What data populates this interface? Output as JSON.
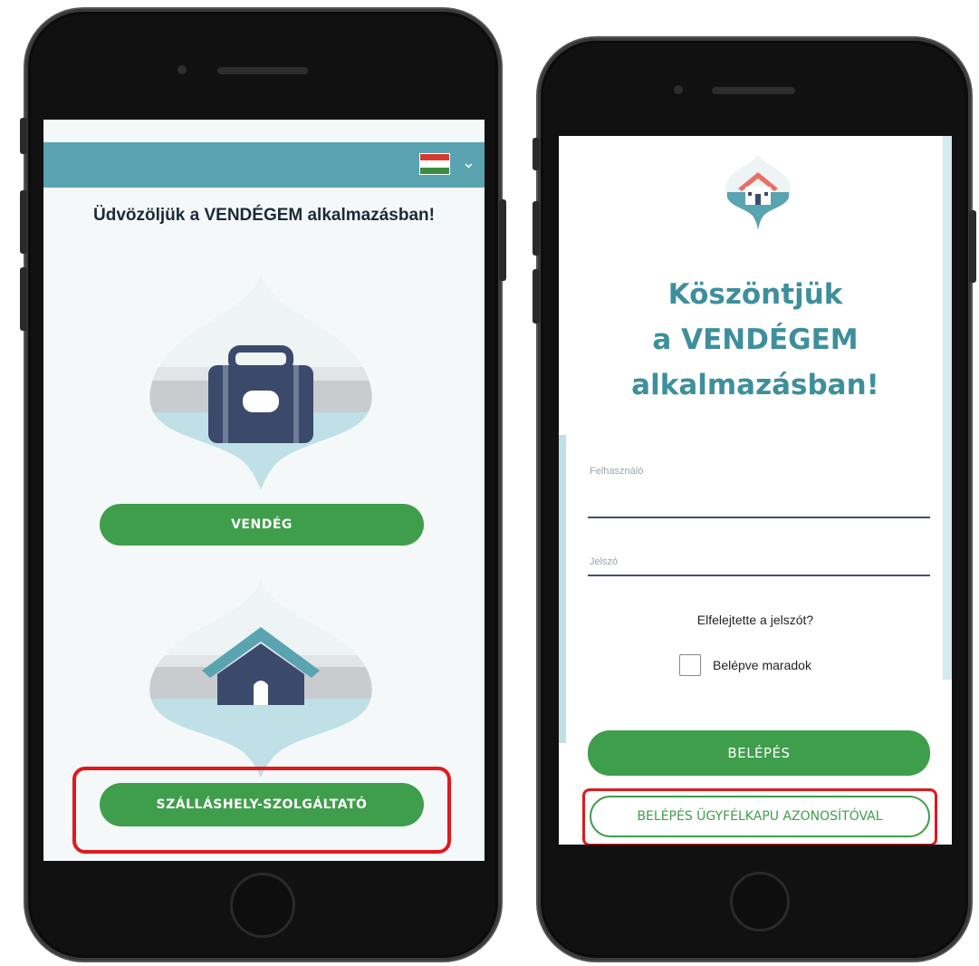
{
  "left_screen": {
    "language_flag": "hungarian-flag",
    "welcome": "Üdvözöljük a VENDÉGEM alkalmazásban!",
    "guest_button": "VENDÉG",
    "provider_button": "SZÁLLÁSHELY-SZOLGÁLTATÓ"
  },
  "right_screen": {
    "title_lines": [
      "Köszöntjük",
      "a VENDÉGEM",
      "alkalmazásban!"
    ],
    "username_placeholder": "Felhasználó",
    "password_placeholder": "Jelszó",
    "forgot_password": "Elfelejtette a jelszót?",
    "stay_logged_in": "Belépve maradok",
    "login_button": "BELÉPÉS",
    "client_gate_button": "BELÉPÉS ÜGYFÉLKAPU AZONOSÍTÓVAL"
  },
  "colors": {
    "accent_teal": "#5aa3b0",
    "primary_green": "#3f9e4b",
    "title_teal": "#3e8f9c",
    "highlight_red": "#e0191d",
    "navy": "#3b4a6b"
  }
}
